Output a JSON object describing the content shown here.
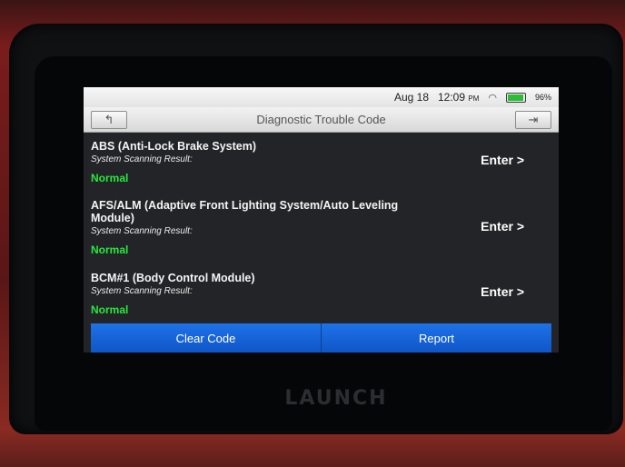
{
  "status": {
    "date": "Aug 18",
    "time": "12:09",
    "ampm": "PM",
    "battery": "96%",
    "battery_level": 0.96
  },
  "header": {
    "title": "Diagnostic Trouble Code",
    "back_icon": "↰",
    "exit_icon": "⇥"
  },
  "systems": [
    {
      "name": "ABS (Anti-Lock Brake System)",
      "scan_label": "System Scanning Result:",
      "result": "Normal",
      "enter": "Enter >"
    },
    {
      "name": "AFS/ALM (Adaptive Front Lighting System/Auto Leveling Module)",
      "scan_label": "System Scanning Result:",
      "result": "Normal",
      "enter": "Enter >"
    },
    {
      "name": "BCM#1 (Body Control Module)",
      "scan_label": "System Scanning Result:",
      "result": "Normal",
      "enter": "Enter >"
    }
  ],
  "footer": {
    "clear_code": "Clear Code",
    "report": "Report"
  },
  "device": {
    "brand": "LAUNCH"
  },
  "colors": {
    "accent_blue": "#1a66db",
    "normal_green": "#27e83c"
  }
}
